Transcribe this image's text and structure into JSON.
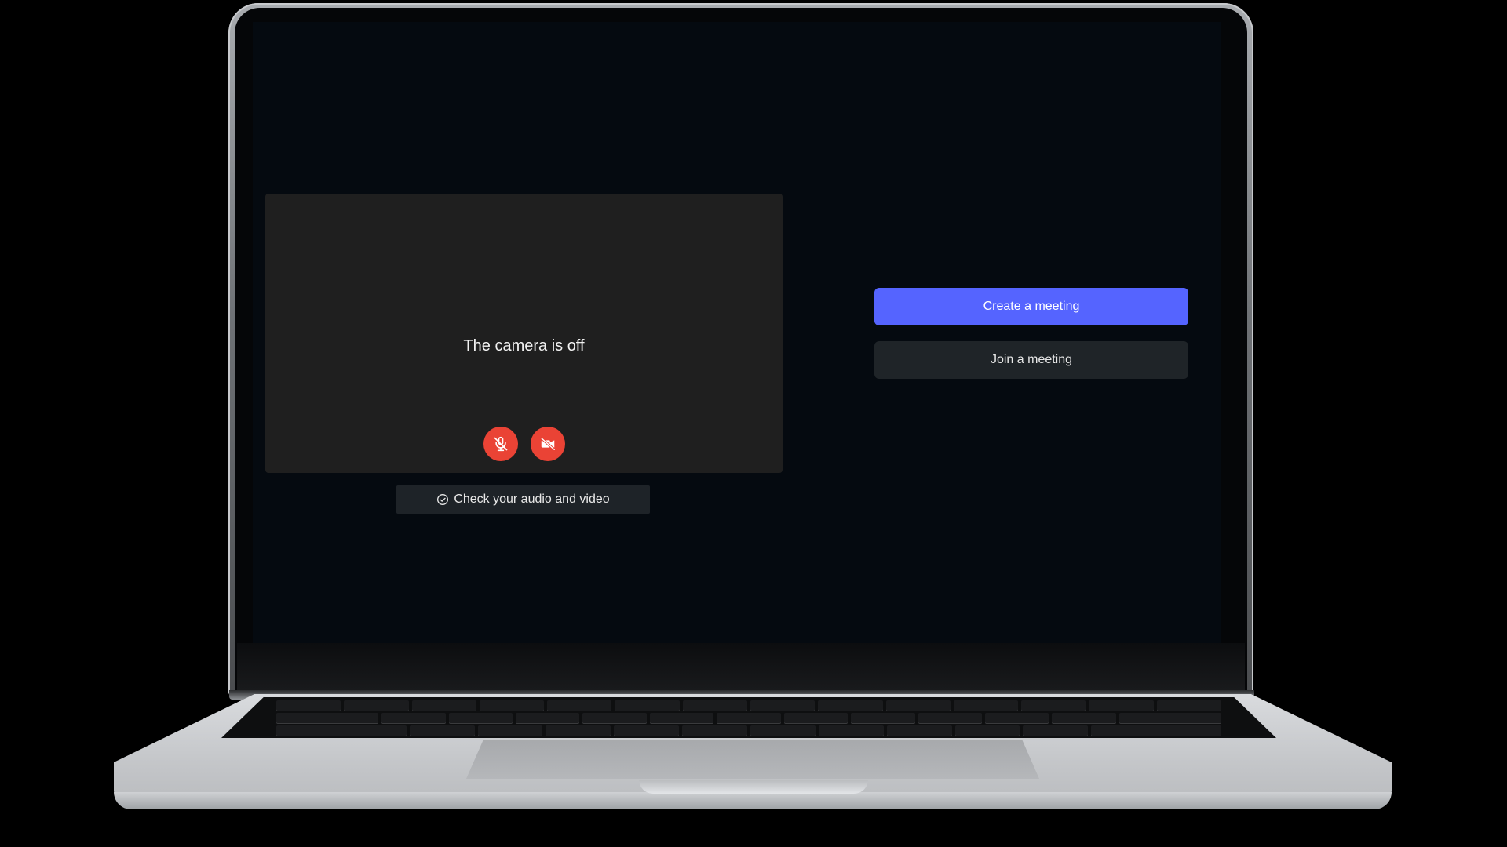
{
  "preview": {
    "status_text": "The camera is off",
    "mic_icon": "mic-off-icon",
    "camera_icon": "video-off-icon",
    "check_label": "Check your audio and video",
    "check_icon": "check-circle-icon"
  },
  "actions": {
    "create_label": "Create a meeting",
    "join_label": "Join a meeting"
  },
  "colors": {
    "accent": "#5564ff",
    "danger": "#ea4335",
    "screen_bg": "#050a10",
    "preview_bg": "#1f1f1f"
  }
}
